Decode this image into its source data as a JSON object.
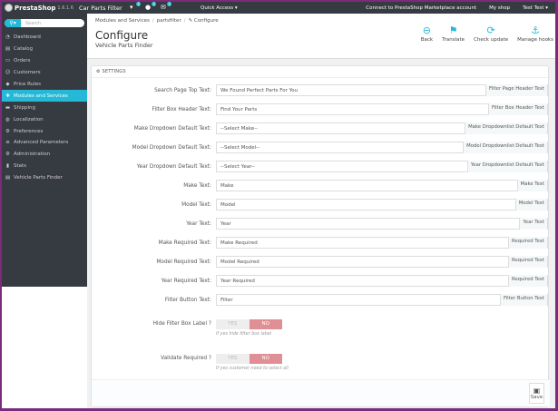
{
  "topbar": {
    "logo_text": "PrestaShop",
    "version": "1.6.1.6",
    "shop_name": "Car Parts Filter",
    "badges": [
      "6",
      "0",
      "0"
    ],
    "quick_access": "Quick Access ▾",
    "connect": "Connect to PrestaShop Marketplace account",
    "my_shop": "My shop",
    "user": "Test Test ▾"
  },
  "sidebar": {
    "search_placeholder": "Search",
    "items": [
      {
        "label": "Dashboard",
        "icon": "dashboard-icon",
        "glyph": "◔"
      },
      {
        "label": "Catalog",
        "icon": "catalog-icon",
        "glyph": "▤"
      },
      {
        "label": "Orders",
        "icon": "orders-icon",
        "glyph": "▭"
      },
      {
        "label": "Customers",
        "icon": "customers-icon",
        "glyph": "☺"
      },
      {
        "label": "Price Rules",
        "icon": "price-rules-icon",
        "glyph": "◆"
      },
      {
        "label": "Modules and Services",
        "icon": "modules-icon",
        "glyph": "✚"
      },
      {
        "label": "Shipping",
        "icon": "shipping-icon",
        "glyph": "▬"
      },
      {
        "label": "Localization",
        "icon": "localization-icon",
        "glyph": "◍"
      },
      {
        "label": "Preferences",
        "icon": "preferences-icon",
        "glyph": "⚙"
      },
      {
        "label": "Advanced Parameters",
        "icon": "advanced-parameters-icon",
        "glyph": "≡"
      },
      {
        "label": "Administration",
        "icon": "administration-icon",
        "glyph": "⚙"
      },
      {
        "label": "Stats",
        "icon": "stats-icon",
        "glyph": "▮"
      },
      {
        "label": "Vehicle Parts Finder",
        "icon": "vehicle-parts-finder-icon",
        "glyph": "▤"
      }
    ]
  },
  "header": {
    "breadcrumb": [
      "Modules and Services",
      "partsfilter",
      "✎ Configure"
    ],
    "title": "Configure",
    "subtitle": "Vehicle Parts Finder",
    "buttons": [
      {
        "label": "Back",
        "icon": "back-icon",
        "glyph": "⊖"
      },
      {
        "label": "Translate",
        "icon": "flag-icon",
        "glyph": "⚑"
      },
      {
        "label": "Check update",
        "icon": "refresh-icon",
        "glyph": "⟳"
      },
      {
        "label": "Manage hooks",
        "icon": "anchor-icon",
        "glyph": "⚓"
      }
    ]
  },
  "panel": {
    "heading": "⚙ SETTINGS",
    "fields": [
      {
        "label": "Search Page Top Text:",
        "value": "We Found Perfect Parts For You",
        "addon": "Filter Page Header Text"
      },
      {
        "label": "Filter Box Header Text:",
        "value": "Find Your Parts",
        "addon": "Filter Box Header Text"
      },
      {
        "label": "Make Dropdown Default Text:",
        "value": "--Select Make--",
        "addon": "Make Dropdownlist Default Text"
      },
      {
        "label": "Model Dropdown Default Text:",
        "value": "--Select Model--",
        "addon": "Model Dropdownlist Default Text"
      },
      {
        "label": "Year Dropdown Default Text:",
        "value": "--Select Year--",
        "addon": "Year Dropdownlist Default Text"
      },
      {
        "label": "Make Text:",
        "value": "Make",
        "addon": "Make Text"
      },
      {
        "label": "Model Text:",
        "value": "Model",
        "addon": "Model Text"
      },
      {
        "label": "Year Text:",
        "value": "Year",
        "addon": "Year Text"
      },
      {
        "label": "Make Required Text:",
        "value": "Make Required",
        "addon": "Required Text"
      },
      {
        "label": "Model Required Text:",
        "value": "Model Required",
        "addon": "Required Text"
      },
      {
        "label": "Year Required Text:",
        "value": "Year Required",
        "addon": "Required Text"
      },
      {
        "label": "Filter Button Text:",
        "value": "Filter",
        "addon": "Filter Button Text"
      }
    ],
    "toggles": [
      {
        "label": "Hide Filter Box Label ?",
        "yes": "YES",
        "no": "NO",
        "help": "If yes hide filter box label"
      },
      {
        "label": "Validate Required ?",
        "yes": "YES",
        "no": "NO",
        "help": "If yes customer need to select all"
      }
    ],
    "save_label": "Save"
  },
  "colors": {
    "accent": "#25b9d7",
    "topbar": "#363a41",
    "toggle_no": "#e08f95"
  }
}
